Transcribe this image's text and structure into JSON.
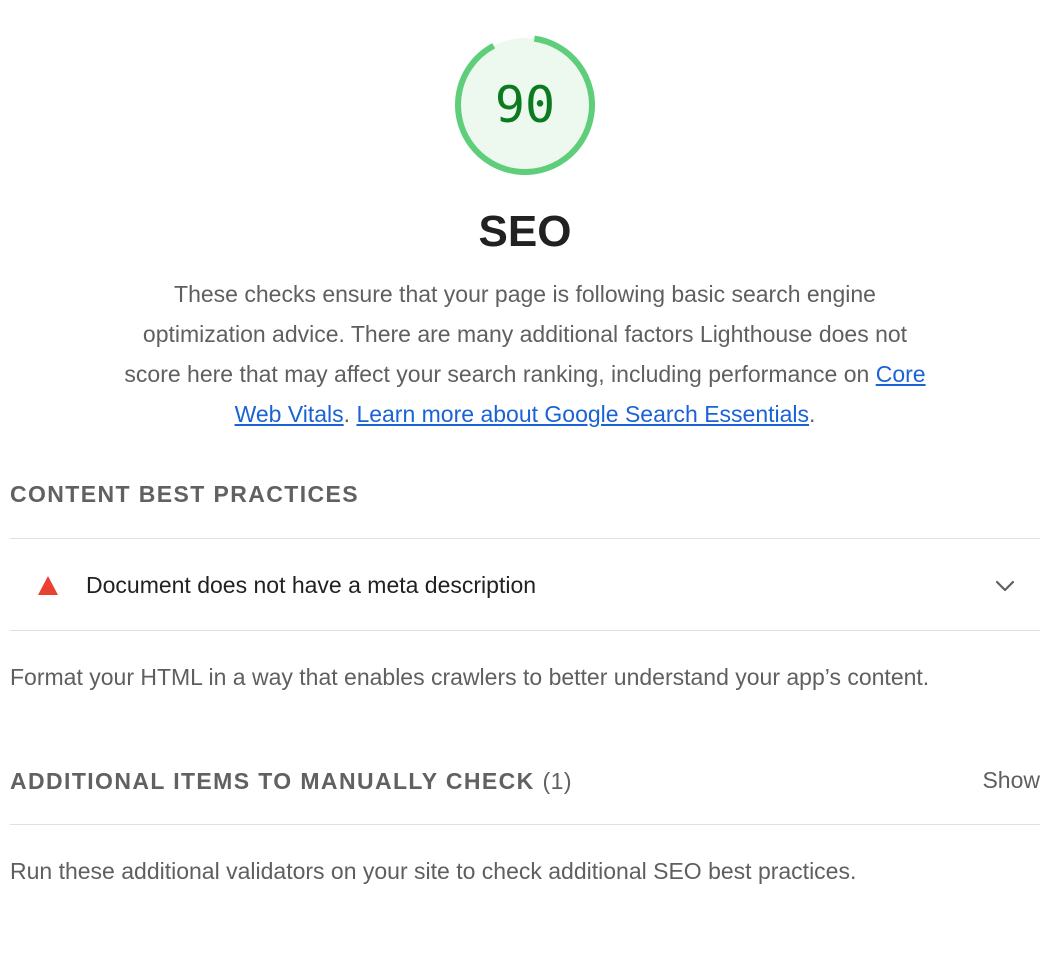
{
  "score": {
    "value": "90",
    "fraction": 0.9,
    "ring_color": "#5ece7a",
    "fill_color": "#edf8ef",
    "text_color": "#0c7a21"
  },
  "category": {
    "title": "SEO",
    "description_part1": "These checks ensure that your page is following basic search engine optimization advice. There are many additional factors Lighthouse does not score here that may affect your search ranking, including performance on ",
    "link1_label": "Core Web Vitals",
    "description_sep": ". ",
    "link2_label": "Learn more about Google Search Essentials",
    "description_end": "."
  },
  "content_group": {
    "title": "CONTENT BEST PRACTICES",
    "audits": [
      {
        "title": "Document does not have a meta description",
        "status_icon": "fail-triangle-icon",
        "status_color": "#eb4133"
      }
    ],
    "description": "Format your HTML in a way that enables crawlers to better understand your app’s content."
  },
  "manual_group": {
    "title": "ADDITIONAL ITEMS TO MANUALLY CHECK",
    "count": "(1)",
    "toggle_label": "Show",
    "description": "Run these additional validators on your site to check additional SEO best practices."
  },
  "colors": {
    "link": "#1a62d6",
    "divider": "#e0e0e0"
  }
}
